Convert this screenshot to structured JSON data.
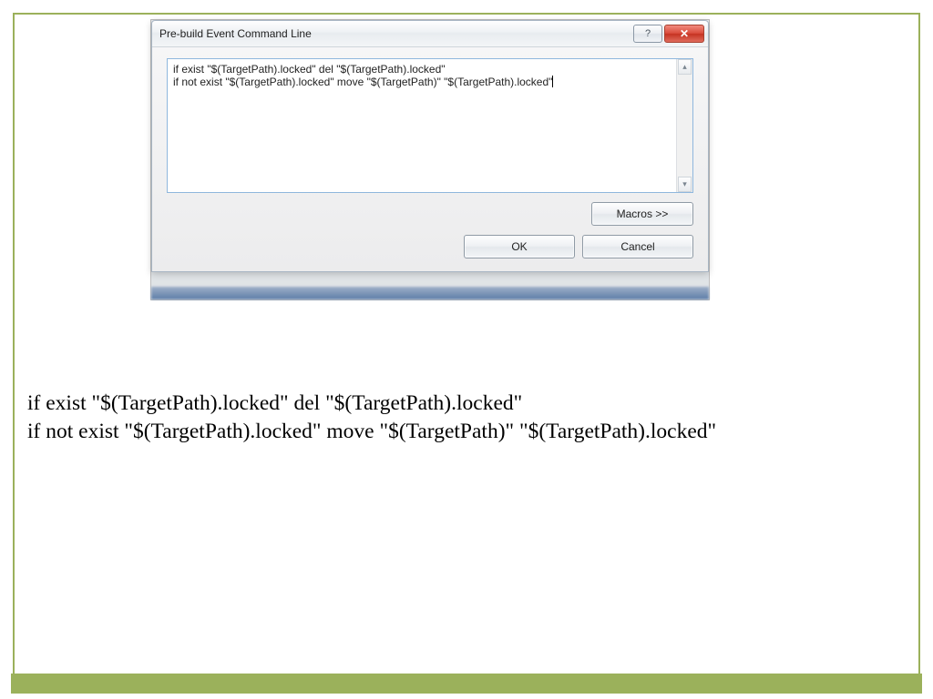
{
  "dialog": {
    "title": "Pre-build Event Command Line",
    "help_icon": "?",
    "close_icon": "✕",
    "textarea_value": "if exist \"$(TargetPath).locked\" del \"$(TargetPath).locked\"\nif not exist \"$(TargetPath).locked\" move \"$(TargetPath)\" \"$(TargetPath).locked\"",
    "scroll_up": "▴",
    "scroll_down": "▾",
    "buttons": {
      "macros": "Macros >>",
      "ok": "OK",
      "cancel": "Cancel"
    }
  },
  "caption_text": "if exist \"$(TargetPath).locked\" del \"$(TargetPath).locked\"\nif not exist \"$(TargetPath).locked\" move \"$(TargetPath)\" \"$(TargetPath).locked\""
}
